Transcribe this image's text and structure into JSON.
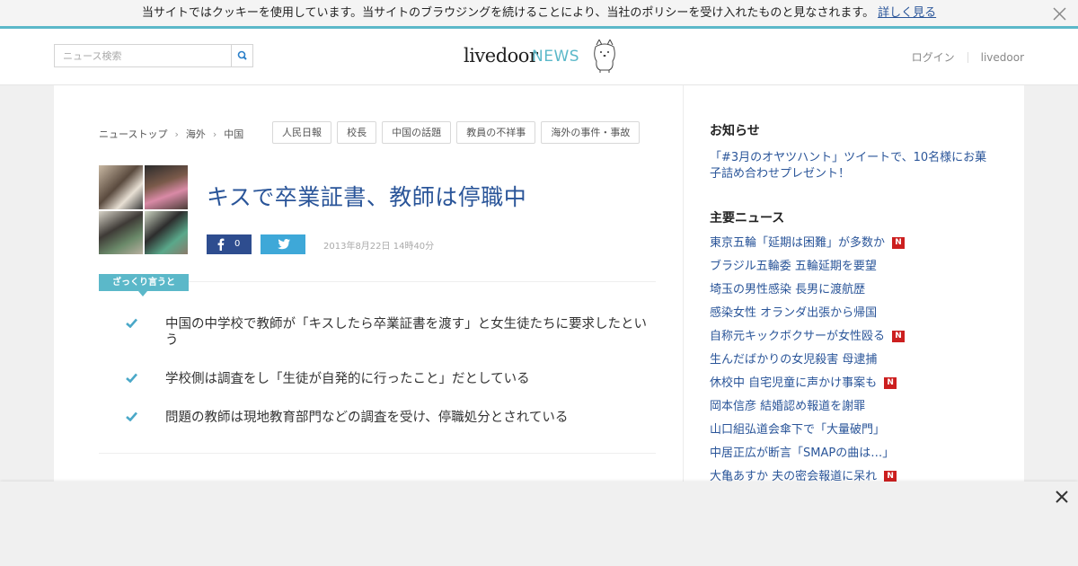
{
  "cookie_bar": {
    "message": "当サイトではクッキーを使用しています。当サイトのブラウジングを続けることにより、当社のポリシーを受け入れたものと見なされます。",
    "link_label": "詳しく見る"
  },
  "header": {
    "search_placeholder": "ニュース検索",
    "logo_main": "livedoor",
    "logo_sub": "NEWS",
    "nav": [
      "ログイン",
      "livedoor"
    ]
  },
  "breadcrumb": [
    "ニューストップ",
    "海外",
    "中国"
  ],
  "tags": [
    "人民日報",
    "校長",
    "中国の話題",
    "教員の不祥事",
    "海外の事件・事故"
  ],
  "article": {
    "title": "キスで卒業証書、教師は停職中",
    "fb_count": "0",
    "date": "2013年8月22日 14時40分",
    "summary_label": "ざっくり言うと",
    "summary": [
      "中国の中学校で教師が「キスしたら卒業証書を渡す」と女生徒たちに要求したという",
      "学校側は調査をし「生徒が自発的に行ったこと」だとしている",
      "問題の教師は現地教育部門などの調査を受け、停職処分とされている"
    ]
  },
  "sidebar": {
    "notice_heading": "お知らせ",
    "notice_text": "「#3月のオヤツハント」ツイートで、10名様にお菓子詰め合わせプレゼント！",
    "news_heading": "主要ニュース",
    "news": [
      {
        "title": "東京五輪「延期は困難」が多数か",
        "badge": "N"
      },
      {
        "title": "ブラジル五輪委 五輪延期を要望",
        "badge": ""
      },
      {
        "title": "埼玉の男性感染 長男に渡航歴",
        "badge": ""
      },
      {
        "title": "感染女性 オランダ出張から帰国",
        "badge": ""
      },
      {
        "title": "自称元キックボクサーが女性殴る",
        "badge": "N"
      },
      {
        "title": "生んだばかりの女児殺害 母逮捕",
        "badge": ""
      },
      {
        "title": "休校中 自宅児童に声かけ事案も",
        "badge": "N"
      },
      {
        "title": "岡本信彦 結婚認め報道を謝罪",
        "badge": ""
      },
      {
        "title": "山口組弘道会傘下で「大量破門」",
        "badge": ""
      },
      {
        "title": "中居正広が断言「SMAPの曲は…」",
        "badge": ""
      },
      {
        "title": "大亀あすか 夫の密会報道に呆れ",
        "badge": "N"
      }
    ]
  },
  "colors": {
    "accent": "#5bb8c9",
    "link": "#2a5599",
    "facebook": "#2e4d8f",
    "twitter": "#3ea8d8",
    "new_badge": "#cc1f1f"
  },
  "icons": [
    "close-icon",
    "search-icon",
    "dog-mascot-icon",
    "facebook-icon",
    "twitter-icon",
    "check-icon"
  ]
}
